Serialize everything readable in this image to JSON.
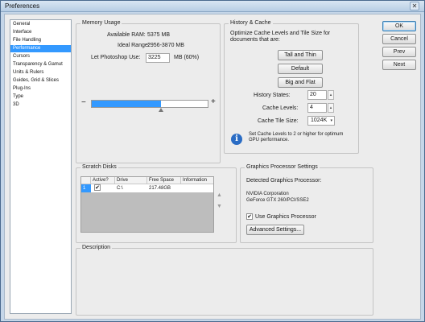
{
  "window": {
    "title": "Preferences"
  },
  "nav": {
    "items": [
      {
        "label": "General"
      },
      {
        "label": "Interface"
      },
      {
        "label": "File Handling"
      },
      {
        "label": "Performance"
      },
      {
        "label": "Cursors"
      },
      {
        "label": "Transparency & Gamut"
      },
      {
        "label": "Units & Rulers"
      },
      {
        "label": "Guides, Grid & Slices"
      },
      {
        "label": "Plug-Ins"
      },
      {
        "label": "Type"
      },
      {
        "label": "3D"
      }
    ],
    "selected": "Performance"
  },
  "memory": {
    "legend": "Memory Usage",
    "available_label": "Available RAM:",
    "available_value": "5375 MB",
    "ideal_label": "Ideal Range:",
    "ideal_value": "2956-3870 MB",
    "let_label": "Let Photoshop Use:",
    "let_value": "3225",
    "let_unit": "MB (60%)",
    "minus": "−",
    "plus": "+",
    "slider_fraction": 0.6
  },
  "history": {
    "legend": "History & Cache",
    "desc": "Optimize Cache Levels and Tile Size for documents that are:",
    "btn_tall": "Tall and Thin",
    "btn_default": "Default",
    "btn_big": "Big and Flat",
    "states_label": "History States:",
    "states_value": "20",
    "levels_label": "Cache Levels:",
    "levels_value": "4",
    "tile_label": "Cache Tile Size:",
    "tile_value": "1024K",
    "note": "Set Cache Levels to 2 or higher for optimum GPU performance.",
    "info_glyph": "i"
  },
  "scratch": {
    "legend": "Scratch Disks",
    "columns": [
      "Active?",
      "Drive",
      "Free Space",
      "Information"
    ],
    "rows": [
      {
        "index": "1",
        "active": "✔",
        "drive": "C:\\",
        "free": "217.48GB",
        "info": ""
      }
    ]
  },
  "gpu": {
    "legend": "Graphics Processor Settings",
    "detected_label": "Detected Graphics Processor:",
    "vendor": "NVIDIA Corporation",
    "model": "GeForce GTX 260/PCI/SSE2",
    "use_label": "Use Graphics Processor",
    "use_checked": "✔",
    "advanced": "Advanced Settings..."
  },
  "description": {
    "legend": "Description"
  },
  "actions": {
    "ok": "OK",
    "cancel": "Cancel",
    "prev": "Prev",
    "next": "Next"
  },
  "icons": {
    "close": "✕",
    "spin_arrow": "▴",
    "dropdown_arrow": "▾",
    "scroll_up": "▲",
    "scroll_down": "▼"
  },
  "colors": {
    "selection": "#3399ff",
    "slider_fill": "#3399ff",
    "info_icon": "#2a6cc4"
  }
}
